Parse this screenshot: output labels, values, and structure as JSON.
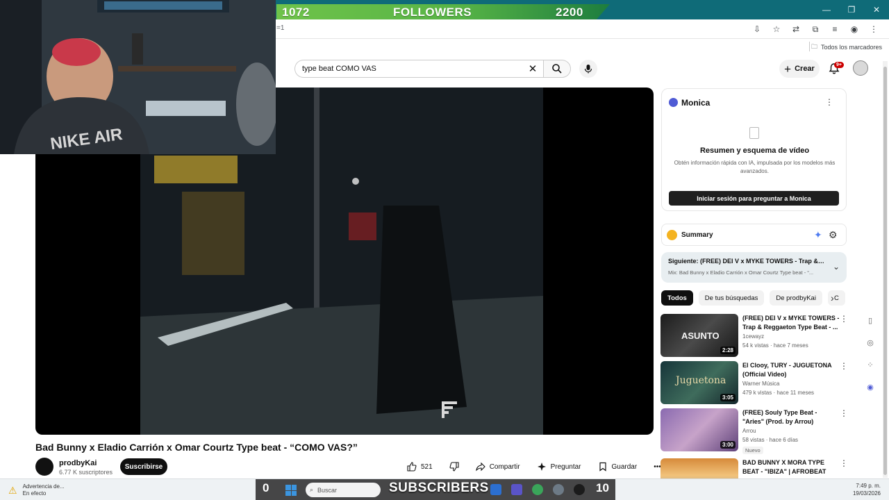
{
  "overlay": {
    "followers_count": "1072",
    "followers_label": "FOLLOWERS",
    "followers_goal": "2200",
    "subscribers_count": "0",
    "subscribers_label": "SUBSCRIBERS",
    "subscribers_goal": "10"
  },
  "browser": {
    "address_fragment": "=1",
    "bookmarks_all": "Todos los marcadores"
  },
  "youtube": {
    "search_value": "type beat COMO VAS",
    "create_label": "Crear",
    "notification_badge": "9+",
    "video_title": "Bad Bunny x Eladio Carrión x Omar Courtz Type beat - “COMO VAS?”",
    "channel_name": "prodbyKai",
    "channel_subs": "6.77 K suscriptores",
    "subscribe_label": "Suscribirse",
    "likes": "521",
    "share_label": "Compartir",
    "ask_label": "Preguntar",
    "save_label": "Guardar"
  },
  "monica": {
    "title": "Monica",
    "heading": "Resumen y esquema de vídeo",
    "description": "Obtén información rápida con IA, impulsada por los modelos más avanzados.",
    "login_button": "Iniciar sesión para preguntar a Monica"
  },
  "summary": {
    "label": "Summary"
  },
  "next_up": {
    "title": "Siguiente: (FREE) DEI V x MYKE TOWERS - Trap & R...",
    "subtitle": "Mix: Bad Bunny x Eladio Carrión x Omar Courtz Type beat - “..."
  },
  "chips": [
    "Todos",
    "De tus búsquedas",
    "De prodbyKai",
    "C"
  ],
  "recommendations": [
    {
      "title": "(FREE) DEI V x MYKE TOWERS - Trap & Reggaeton Type Beat - ...",
      "channel": "1cewayz",
      "meta": "54 k vistas · hace 7 meses",
      "duration": "2:28",
      "thumb_text": "ASUNTO",
      "new_label": ""
    },
    {
      "title": "El Clooy, TURY - JUGUETONA (Official Video)",
      "channel": "Warner Música",
      "meta": "479 k vistas · hace 11 meses",
      "duration": "3:05",
      "thumb_text": "Juguetona",
      "new_label": ""
    },
    {
      "title": "(FREE) Souly Type Beat - \"Aries\" (Prod. by Arrou)",
      "channel": "Arrou",
      "meta": "58 vistas · hace 6 días",
      "duration": "3:00",
      "thumb_text": "",
      "new_label": "Nuevo"
    },
    {
      "title": "BAD BUNNY X MORA TYPE BEAT - \"IBIZA\" | AFROBEAT",
      "channel": "",
      "meta": "",
      "duration": "",
      "thumb_text": "",
      "new_label": ""
    }
  ],
  "taskbar": {
    "warning_title": "Advertencia de...",
    "warning_sub": "En efecto",
    "search_placeholder": "Buscar",
    "time": "7:49 p. m.",
    "date": "19/03/2026"
  },
  "colors": {
    "chrome_teal": "#0f6b78",
    "followers_green": "#57b446",
    "yt_red": "#cc0000"
  }
}
